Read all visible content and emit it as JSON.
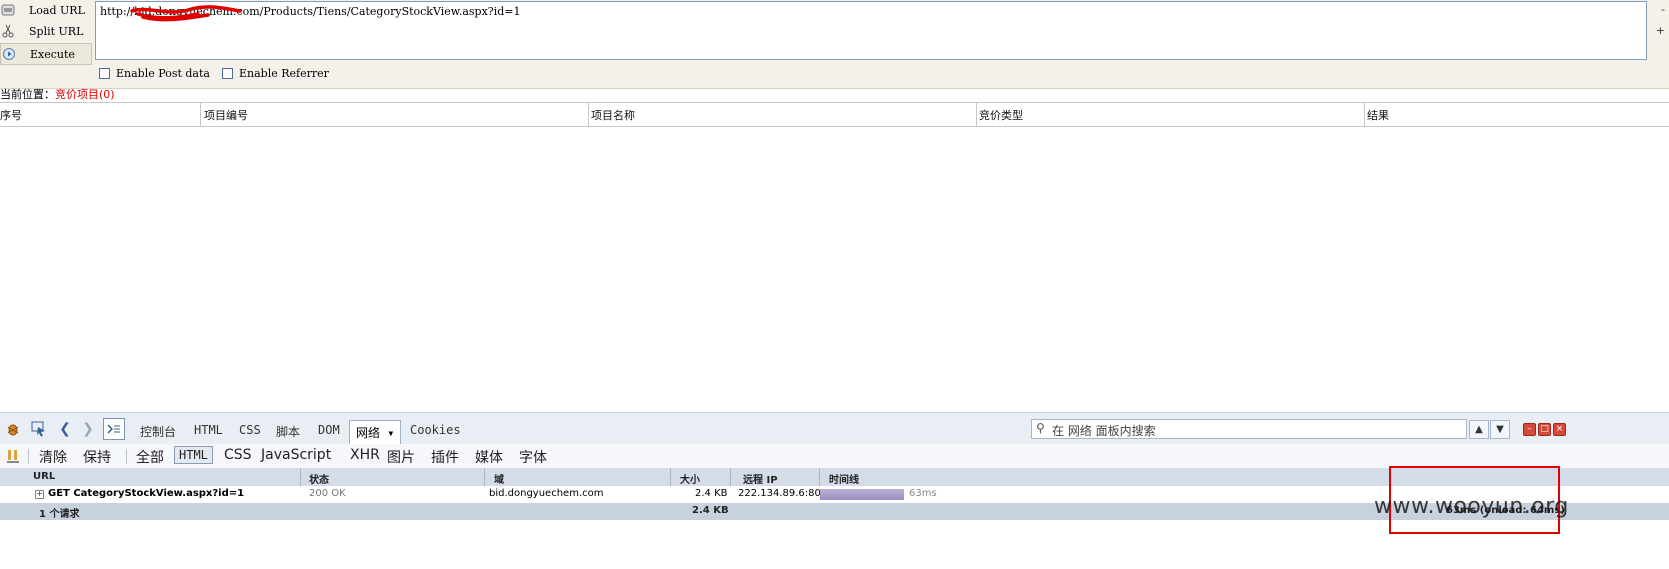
{
  "hackbar": {
    "buttons": [
      {
        "label": "Load URL",
        "icon": "load-url-icon"
      },
      {
        "label": "Split URL",
        "icon": "scissors-icon"
      },
      {
        "label": "Execute",
        "icon": "play-icon"
      }
    ],
    "url": "http://bid.dongyuechem.com/Products/Tiens/CategoryStockView.aspx?id=1",
    "side_minus": "-",
    "side_plus": "+",
    "enable_post": "Enable Post data",
    "enable_referrer": "Enable Referrer"
  },
  "page": {
    "breadcrumb_prefix": "当前位置：",
    "breadcrumb_current": "竞价项目(0)",
    "columns": [
      "序号",
      "项目编号",
      "项目名称",
      "竞价类型",
      "结果"
    ]
  },
  "firebug": {
    "tabs": [
      "控制台",
      "HTML",
      "CSS",
      "脚本",
      "DOM",
      "网络 ▾",
      "Cookies"
    ],
    "search_placeholder": "在 网络 面板内搜索",
    "subtoolbar": {
      "clear": "清除",
      "persist": "保持",
      "filters": [
        "全部",
        "HTML",
        "CSS",
        "JavaScript",
        "XHR",
        "图片",
        "插件",
        "媒体",
        "字体"
      ]
    },
    "net_columns": {
      "url": "URL",
      "status": "状态",
      "domain": "域",
      "size": "大小",
      "remote_ip": "远程 IP",
      "timeline": "时间线"
    },
    "request": {
      "url": "GET CategoryStockView.aspx?id=1",
      "status": "200 OK",
      "domain": "bid.dongyuechem.com",
      "size": "2.4 KB",
      "remote_ip": "222.134.89.6:80",
      "time": "63ms"
    },
    "summary": {
      "count": "1 个请求",
      "size": "2.4 KB",
      "timing": "63ms (onload: 64ms)"
    }
  },
  "watermark": "www.wooyun.org",
  "colors": {
    "highlight": "#e00000",
    "timeline_bar": "#9b8cc0"
  }
}
